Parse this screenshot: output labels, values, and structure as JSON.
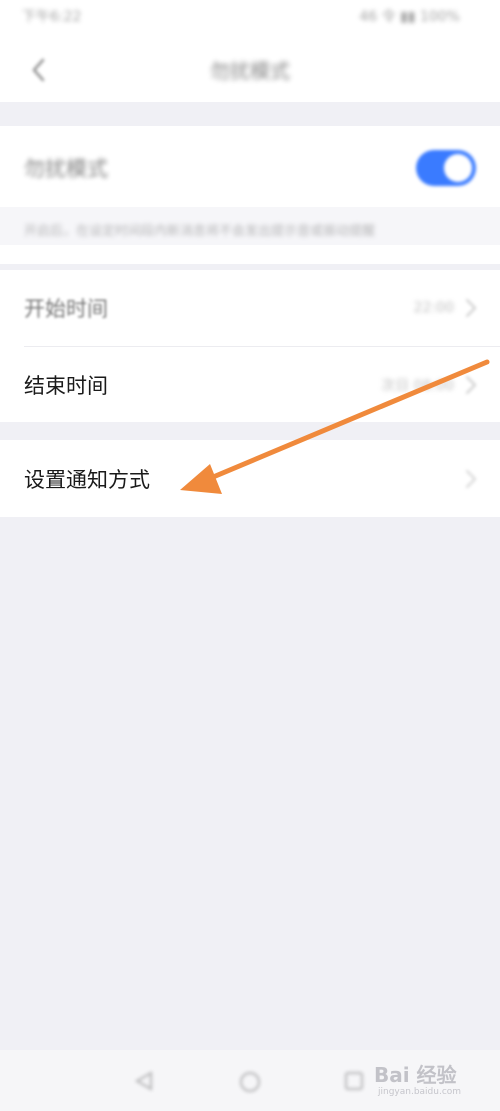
{
  "status_bar": {
    "time": "下午6:22",
    "right_text": "46  令 ▮▮ 100%"
  },
  "header": {
    "back_icon": "chevron-left-icon",
    "title": "勿扰模式"
  },
  "dnd_section": {
    "label": "勿扰模式",
    "toggle_on": true,
    "description": "开启后，在设定时间段内新消息将不会发出提示音或振动提醒"
  },
  "schedule_section": {
    "start": {
      "label": "开始时间",
      "value": "22:00"
    },
    "end": {
      "label": "结束时间",
      "value": "次日 08:00"
    }
  },
  "notify_section": {
    "label": "设置通知方式",
    "chevron_icon": "chevron-right-icon"
  },
  "annotation": {
    "type": "arrow",
    "color": "#f08a3c"
  },
  "bottom_nav": {
    "icons": [
      "back-triangle-icon",
      "home-circle-icon",
      "recents-square-icon"
    ]
  },
  "watermark": {
    "text": "Bai 经验",
    "sub": "jingyan.baidu.com"
  },
  "colors": {
    "accent": "#3a7bff",
    "background": "#f0f0f5",
    "card": "#ffffff"
  }
}
